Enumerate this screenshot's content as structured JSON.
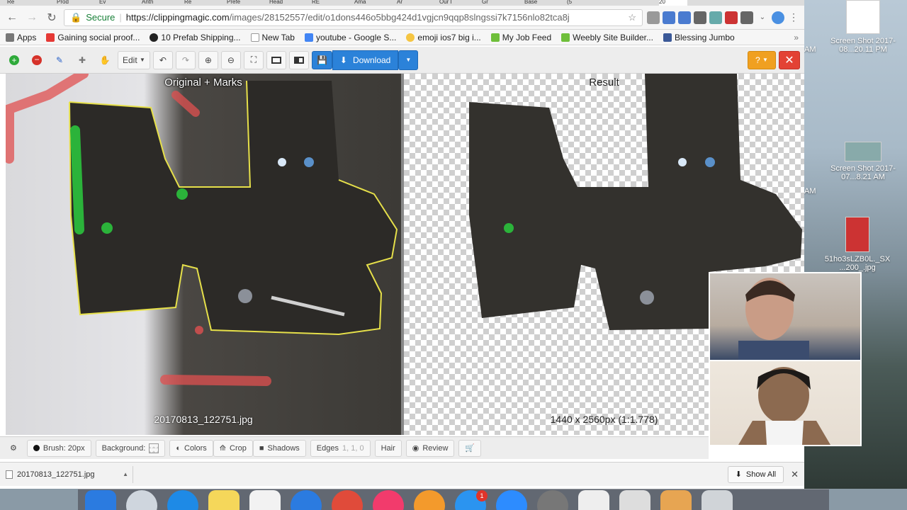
{
  "browser": {
    "tabs": [
      "Re",
      "Prod",
      "Ev",
      "Anth",
      "Re",
      "Prefe",
      "Head",
      "RE",
      "Ama",
      "Ar",
      "Our I",
      "Gr",
      "Base",
      "(5",
      "20"
    ],
    "address": {
      "secure_label": "Secure",
      "url_host": "https://clippingmagic.com",
      "url_path": "/images/28152557/edit/o1dons446o5bbg424d1vgjcn9qqp8slngssi7k7156nlo82tca8j"
    },
    "bookmarks": [
      {
        "label": "Apps",
        "color": "#777777"
      },
      {
        "label": "Gaining social proof...",
        "color": "#e53935"
      },
      {
        "label": "10 Prefab Shipping...",
        "color": "#222222"
      },
      {
        "label": "New Tab",
        "color": "#9e9e9e"
      },
      {
        "label": "youtube - Google S...",
        "color": "#4285f4"
      },
      {
        "label": "emoji ios7 big i...",
        "color": "#9e9e9e"
      },
      {
        "label": "My Job Feed",
        "color": "#6fbf3a"
      },
      {
        "label": "Weebly Site Builder...",
        "color": "#6fbf3a"
      },
      {
        "label": "Blessing Jumbo",
        "color": "#3b5998"
      }
    ]
  },
  "toolbar": {
    "edit_label": "Edit",
    "download_label": "Download",
    "help_label": "?"
  },
  "panes": {
    "left_label": "Original + Marks",
    "left_caption": "20170813_122751.jpg",
    "right_label": "Result",
    "right_caption": "1440 x 2560px (1:1.778)"
  },
  "bottombar": {
    "brush_label": "Brush: 20px",
    "background_label": "Background:",
    "colors_label": "Colors",
    "crop_label": "Crop",
    "shadows_label": "Shadows",
    "edges_label": "Edges",
    "edges_value": "1, 1, 0",
    "hair_label": "Hair",
    "review_label": "Review"
  },
  "shelf": {
    "file_name": "20170813_122751.jpg",
    "show_all_label": "Show All"
  },
  "desktop": {
    "items": [
      {
        "label": "Screen Shot 2017-08...20.11 PM"
      },
      {
        "label": "Screen Shot 2017-07...8.21 AM"
      },
      {
        "label": "51ho3sLZB0L._SX ...200_.jpg"
      }
    ],
    "partial_times": [
      "AM",
      "AM"
    ]
  },
  "dock": {
    "badge_count": "1"
  }
}
